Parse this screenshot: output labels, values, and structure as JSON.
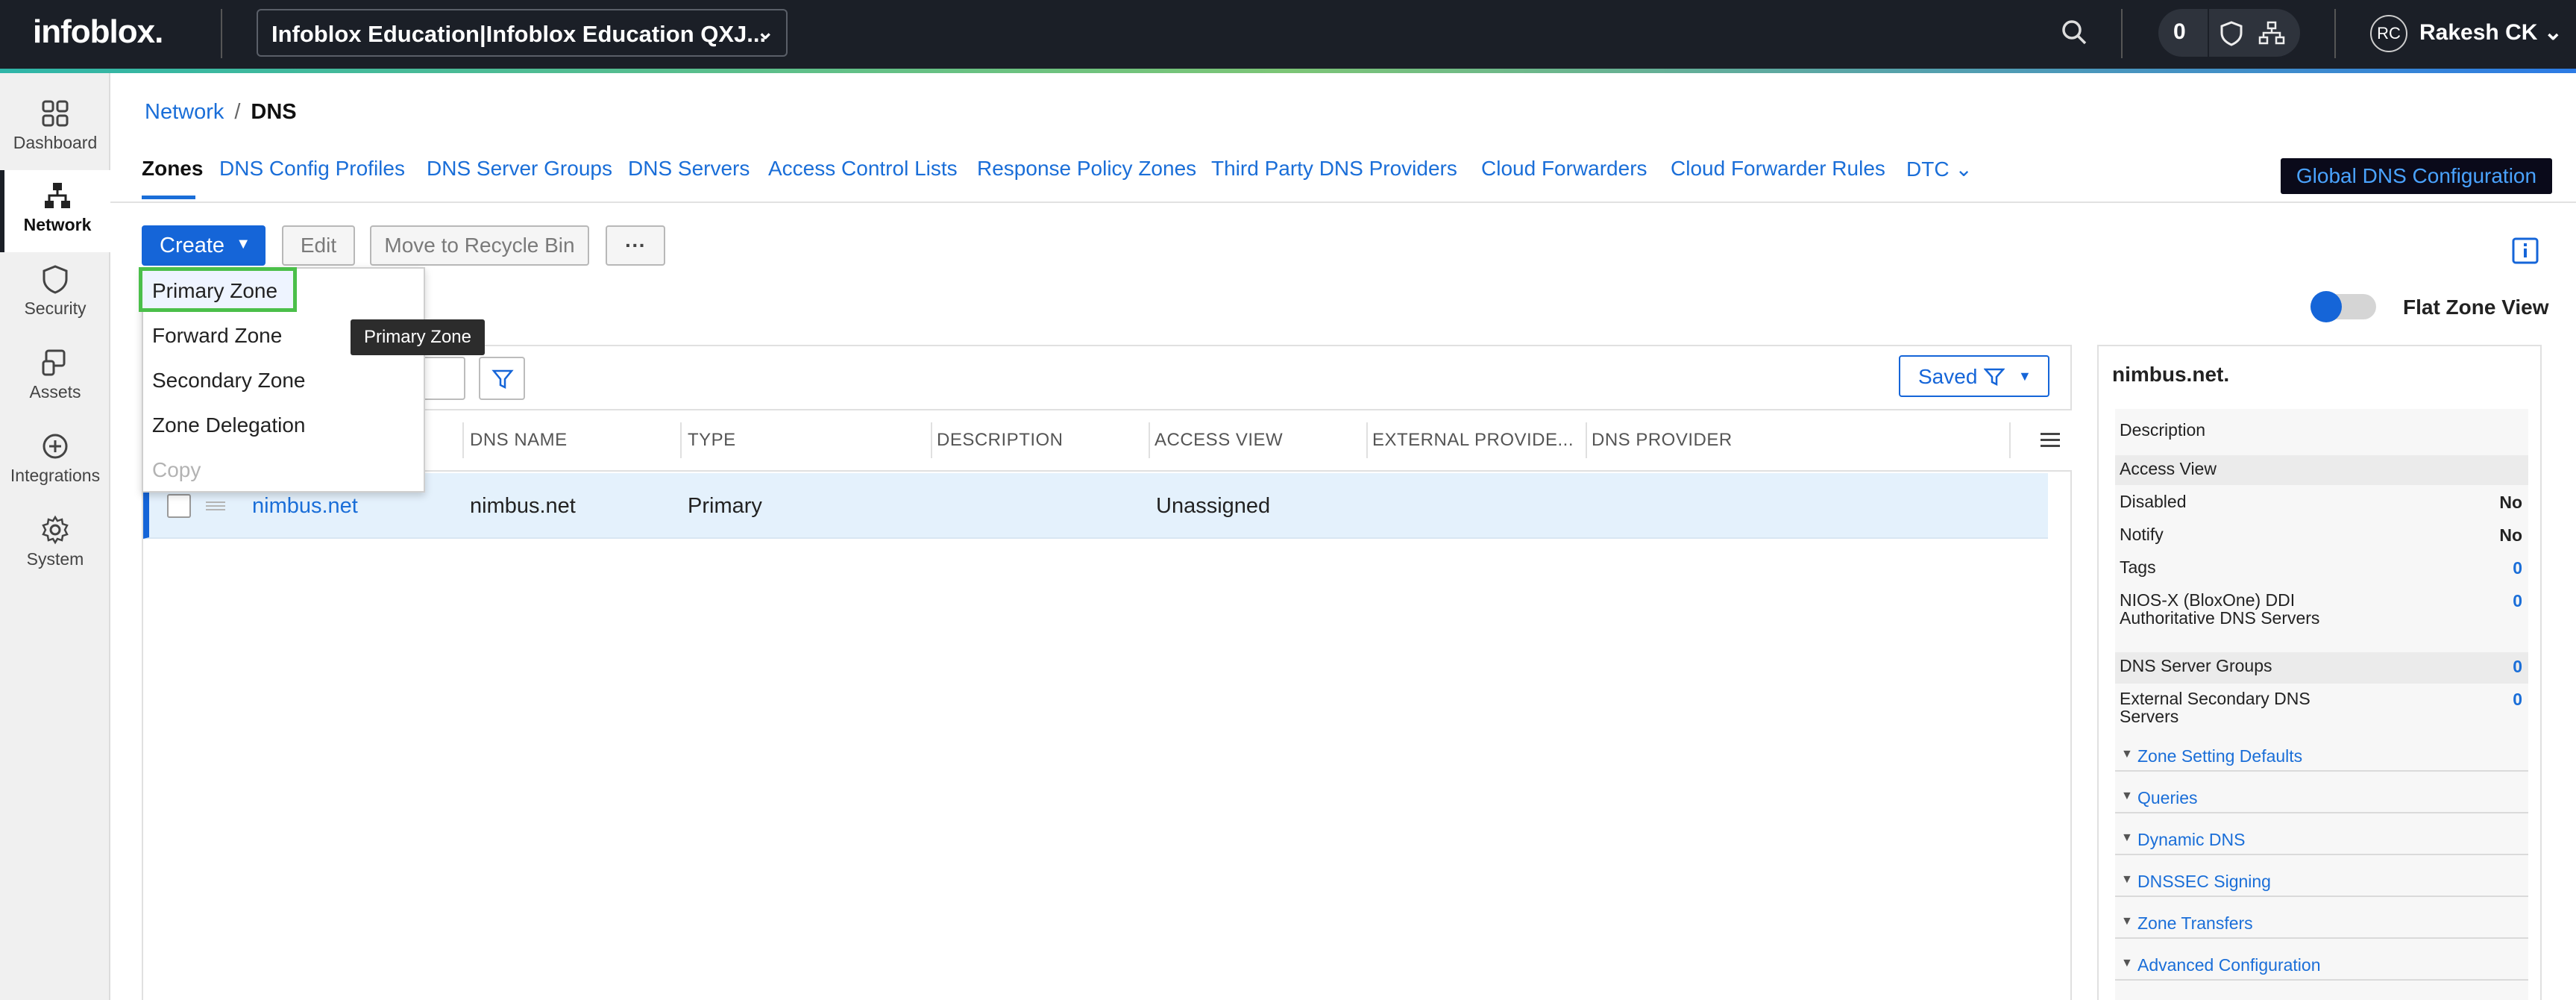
{
  "topbar": {
    "logo": "infoblox.",
    "org": "Infoblox Education|Infoblox Education QXJ...",
    "notification_count": "0",
    "user_initials": "RC",
    "user_name": "Rakesh CK"
  },
  "leftnav": [
    {
      "label": "Dashboard",
      "icon": "grid-icon"
    },
    {
      "label": "Network",
      "icon": "network-icon"
    },
    {
      "label": "Security",
      "icon": "shield-icon"
    },
    {
      "label": "Assets",
      "icon": "devices-icon"
    },
    {
      "label": "Integrations",
      "icon": "integrations-icon"
    },
    {
      "label": "System",
      "icon": "gear-icon"
    }
  ],
  "breadcrumb": {
    "parent": "Network",
    "separator": "/",
    "current": "DNS"
  },
  "tabs": [
    "Zones",
    "DNS Config Profiles",
    "DNS Server Groups",
    "DNS Servers",
    "Access Control Lists",
    "Response Policy Zones",
    "Third Party DNS Providers",
    "Cloud Forwarders",
    "Cloud Forwarder Rules",
    "DTC"
  ],
  "global_button": "Global DNS Configuration",
  "toolbar": {
    "create": "Create",
    "edit": "Edit",
    "recycle": "Move to Recycle Bin",
    "more": "···"
  },
  "create_menu": {
    "items": [
      "Primary Zone",
      "Forward Zone",
      "Secondary Zone",
      "Zone Delegation",
      "Copy"
    ],
    "tooltip": "Primary Zone"
  },
  "flat_zone_view": {
    "label": "Flat Zone View",
    "enabled": true
  },
  "saved_filter": "Saved",
  "grid": {
    "columns": [
      "DNS NAME",
      "TYPE",
      "DESCRIPTION",
      "ACCESS VIEW",
      "EXTERNAL PROVIDE...",
      "DNS PROVIDER"
    ],
    "rows": [
      {
        "name": "nimbus.net",
        "dns_name": "nimbus.net",
        "type": "Primary",
        "description": "",
        "access_view": "Unassigned",
        "external_provider": "",
        "dns_provider": ""
      }
    ]
  },
  "detail": {
    "title": "nimbus.net.",
    "description_label": "Description",
    "access_view_label": "Access View",
    "disabled": {
      "label": "Disabled",
      "value": "No"
    },
    "notify": {
      "label": "Notify",
      "value": "No"
    },
    "tags": {
      "label": "Tags",
      "value": "0"
    },
    "nios": {
      "label": "NIOS-X (BloxOne) DDI Authoritative DNS Servers",
      "value": "0"
    },
    "server_groups": {
      "label": "DNS Server Groups",
      "value": "0"
    },
    "external_secondary": {
      "label": "External Secondary DNS Servers",
      "value": "0"
    },
    "sections": [
      "Zone Setting Defaults",
      "Queries",
      "Dynamic DNS",
      "DNSSEC Signing",
      "Zone Transfers",
      "Advanced Configuration"
    ]
  },
  "colors": {
    "accent": "#1565d8",
    "topbar": "#1b1f27",
    "highlight": "#4bbf4a"
  }
}
